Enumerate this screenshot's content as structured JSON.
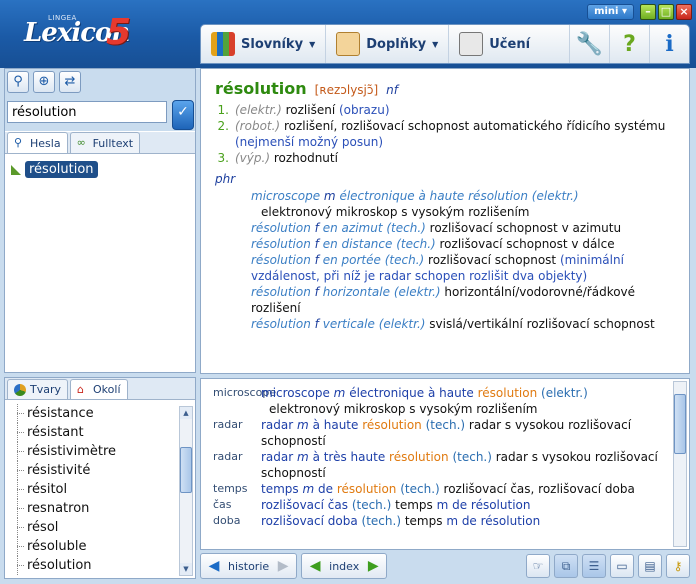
{
  "app": {
    "logo_small": "LINGEA",
    "logo_word": "Lexicon",
    "logo_number": "5",
    "mini_label": "mini"
  },
  "toolbar": {
    "menus": [
      {
        "label": "Slovníky",
        "icon": "books-icon"
      },
      {
        "label": "Doplňky",
        "icon": "document-icon"
      },
      {
        "label": "Učení",
        "icon": "abc-blocks-icon"
      }
    ]
  },
  "search": {
    "value": "résolution",
    "tabs": [
      {
        "label": "Hesla",
        "active": true
      },
      {
        "label": "Fulltext",
        "active": false
      }
    ],
    "results": [
      "résolution"
    ]
  },
  "neighbors": {
    "tabs": [
      {
        "label": "Tvary",
        "active": false
      },
      {
        "label": "Okolí",
        "active": true
      }
    ],
    "items": [
      "résistance",
      "résistant",
      "résistivimètre",
      "résistivité",
      "résitol",
      "resnatron",
      "résol",
      "résoluble",
      "résolution"
    ]
  },
  "entry": {
    "headword": "résolution",
    "pronunciation": "[ʀezɔlysjɔ̃]",
    "pos": "nf",
    "senses": [
      {
        "num": "1.",
        "domain": "(elektr.)",
        "text": "rozlišení",
        "note": "(obrazu)"
      },
      {
        "num": "2.",
        "domain": "(robot.)",
        "text": "rozlišení, rozlišovací schopnost automatického řídicího systému",
        "note": "(nejmenší možný posun)"
      },
      {
        "num": "3.",
        "domain": "(výp.)",
        "text": "rozhodnutí",
        "note": ""
      }
    ],
    "phr_label": "phr",
    "phrases": [
      {
        "fr1": "microscope",
        "g": "m",
        "fr2": "électronique à haute résolution",
        "domain": "(elektr.)",
        "tr": "elektronový mikroskop s vysokým rozlišením",
        "extra": ""
      },
      {
        "fr1": "résolution",
        "g": "f",
        "fr2": "en azimut",
        "domain": "(tech.)",
        "tr": "rozlišovací schopnost v azimutu",
        "extra": ""
      },
      {
        "fr1": "résolution",
        "g": "f",
        "fr2": "en distance",
        "domain": "(tech.)",
        "tr": "rozlišovací schopnost v dálce",
        "extra": ""
      },
      {
        "fr1": "résolution",
        "g": "f",
        "fr2": "en portée",
        "domain": "(tech.)",
        "tr": "rozlišovací schopnost",
        "extra": "(minimální vzdálenost, při níž je radar schopen rozlišit dva objekty)"
      },
      {
        "fr1": "résolution",
        "g": "f",
        "fr2": "horizontale",
        "domain": "(elektr.)",
        "tr": "horizontální/vodorovné/řádkové rozlišení",
        "extra": ""
      },
      {
        "fr1": "résolution",
        "g": "f",
        "fr2": "verticale",
        "domain": "(elektr.)",
        "tr": "svislá/vertikální rozlišovací schopnost",
        "extra": ""
      }
    ]
  },
  "examples": [
    {
      "key": "microscope",
      "fr_a": "microscope",
      "g": "m",
      "fr_b": "électronique à haute",
      "hl": "résolution",
      "dom": "(elektr.)",
      "cz": "elektronový mikroskop s vysokým rozlišením",
      "tail": ""
    },
    {
      "key": "radar",
      "fr_a": "radar",
      "g": "m",
      "fr_b": "à haute",
      "hl": "résolution",
      "dom": "(tech.)",
      "cz": "radar s vysokou rozlišovací schopností",
      "tail": ""
    },
    {
      "key": "radar",
      "fr_a": "radar",
      "g": "m",
      "fr_b": "à très haute",
      "hl": "résolution",
      "dom": "(tech.)",
      "cz": "radar s vysokou rozlišovací schopností",
      "tail": ""
    },
    {
      "key": "temps",
      "fr_a": "temps",
      "g": "m",
      "fr_b": "de",
      "hl": "résolution",
      "dom": "(tech.)",
      "cz": "rozlišovací čas, rozlišovací doba",
      "tail": ""
    },
    {
      "key": "čas",
      "fr_a": "rozlišovací čas",
      "g": "",
      "fr_b": "",
      "hl": "",
      "dom": "(tech.)",
      "cz": "temps",
      "tail": "m de résolution"
    },
    {
      "key": "doba",
      "fr_a": "rozlišovací doba",
      "g": "",
      "fr_b": "",
      "hl": "",
      "dom": "(tech.)",
      "cz": "temps",
      "tail": "m de résolution"
    }
  ],
  "navbar": {
    "history_label": "historie",
    "index_label": "index"
  }
}
